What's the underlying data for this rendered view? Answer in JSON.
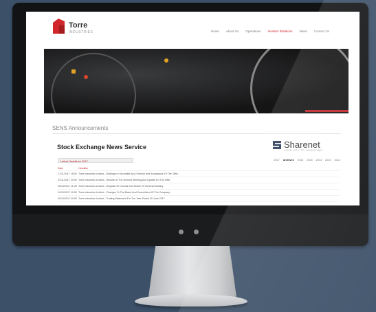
{
  "site": {
    "logo_name": "Torre",
    "logo_sub": "INDUSTRIES",
    "nav": [
      "Home",
      "About Us",
      "Operations",
      "Investor Relations",
      "News",
      "Contact Us"
    ],
    "active_nav_index": 3,
    "accent_color": "#d0262c"
  },
  "page": {
    "section_title": "SENS Announcements",
    "service_title": "Stock Exchange News Service",
    "sharenet_name": "Sharenet",
    "sharenet_tagline": "YOUR KEY TO INVESTING",
    "filter_label": "Latest Headlines 2017",
    "years": [
      "2017",
      "Archives",
      "2016",
      "2015",
      "2014",
      "2013",
      "2012"
    ],
    "table": {
      "headers": [
        "Date",
        "Headline"
      ],
      "rows": [
        {
          "date": "17/11/2017 15:00",
          "headline": "Torre Industries Limited - Dealings In Securities By A Director And Acceptance Of The Offer..."
        },
        {
          "date": "07/11/2017 10:00",
          "headline": "Torre Industries Limited - Results Of The General Meeting And Update On The Offer"
        },
        {
          "date": "26/10/2017 11:30",
          "headline": "Torre Industries Limited - Dispatch Of Circular And Notice Of General Meeting"
        },
        {
          "date": "24/10/2017 10:00",
          "headline": "Torre Industries Limited - Changes To The Board And Committees Of The Company"
        },
        {
          "date": "20/10/2017 09:00",
          "headline": "Torre Industries Limited - Trading Statement For The Year Ended 30 June 2017"
        }
      ]
    }
  }
}
